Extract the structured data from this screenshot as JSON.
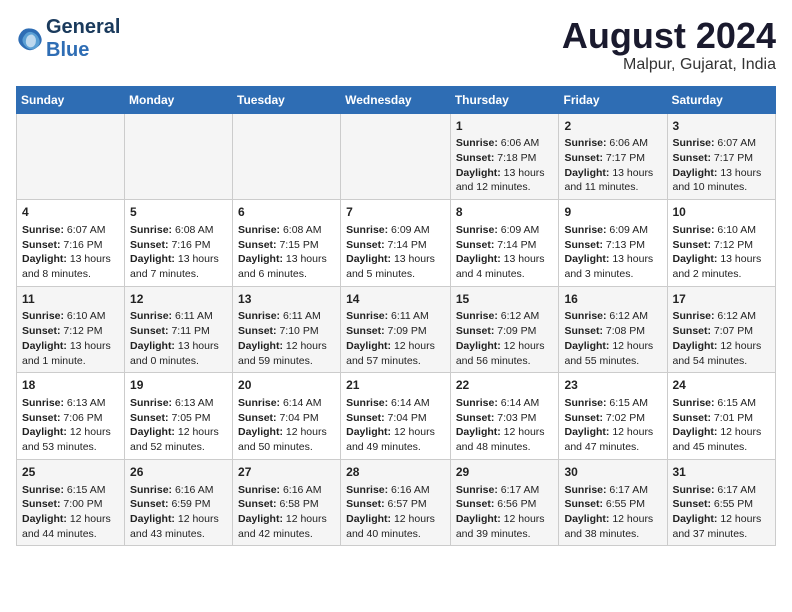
{
  "header": {
    "logo_line1": "General",
    "logo_line2": "Blue",
    "month_title": "August 2024",
    "location": "Malpur, Gujarat, India"
  },
  "weekdays": [
    "Sunday",
    "Monday",
    "Tuesday",
    "Wednesday",
    "Thursday",
    "Friday",
    "Saturday"
  ],
  "weeks": [
    [
      {
        "day": "",
        "info": ""
      },
      {
        "day": "",
        "info": ""
      },
      {
        "day": "",
        "info": ""
      },
      {
        "day": "",
        "info": ""
      },
      {
        "day": "1",
        "info": "Sunrise: 6:06 AM\nSunset: 7:18 PM\nDaylight: 13 hours and 12 minutes."
      },
      {
        "day": "2",
        "info": "Sunrise: 6:06 AM\nSunset: 7:17 PM\nDaylight: 13 hours and 11 minutes."
      },
      {
        "day": "3",
        "info": "Sunrise: 6:07 AM\nSunset: 7:17 PM\nDaylight: 13 hours and 10 minutes."
      }
    ],
    [
      {
        "day": "4",
        "info": "Sunrise: 6:07 AM\nSunset: 7:16 PM\nDaylight: 13 hours and 8 minutes."
      },
      {
        "day": "5",
        "info": "Sunrise: 6:08 AM\nSunset: 7:16 PM\nDaylight: 13 hours and 7 minutes."
      },
      {
        "day": "6",
        "info": "Sunrise: 6:08 AM\nSunset: 7:15 PM\nDaylight: 13 hours and 6 minutes."
      },
      {
        "day": "7",
        "info": "Sunrise: 6:09 AM\nSunset: 7:14 PM\nDaylight: 13 hours and 5 minutes."
      },
      {
        "day": "8",
        "info": "Sunrise: 6:09 AM\nSunset: 7:14 PM\nDaylight: 13 hours and 4 minutes."
      },
      {
        "day": "9",
        "info": "Sunrise: 6:09 AM\nSunset: 7:13 PM\nDaylight: 13 hours and 3 minutes."
      },
      {
        "day": "10",
        "info": "Sunrise: 6:10 AM\nSunset: 7:12 PM\nDaylight: 13 hours and 2 minutes."
      }
    ],
    [
      {
        "day": "11",
        "info": "Sunrise: 6:10 AM\nSunset: 7:12 PM\nDaylight: 13 hours and 1 minute."
      },
      {
        "day": "12",
        "info": "Sunrise: 6:11 AM\nSunset: 7:11 PM\nDaylight: 13 hours and 0 minutes."
      },
      {
        "day": "13",
        "info": "Sunrise: 6:11 AM\nSunset: 7:10 PM\nDaylight: 12 hours and 59 minutes."
      },
      {
        "day": "14",
        "info": "Sunrise: 6:11 AM\nSunset: 7:09 PM\nDaylight: 12 hours and 57 minutes."
      },
      {
        "day": "15",
        "info": "Sunrise: 6:12 AM\nSunset: 7:09 PM\nDaylight: 12 hours and 56 minutes."
      },
      {
        "day": "16",
        "info": "Sunrise: 6:12 AM\nSunset: 7:08 PM\nDaylight: 12 hours and 55 minutes."
      },
      {
        "day": "17",
        "info": "Sunrise: 6:12 AM\nSunset: 7:07 PM\nDaylight: 12 hours and 54 minutes."
      }
    ],
    [
      {
        "day": "18",
        "info": "Sunrise: 6:13 AM\nSunset: 7:06 PM\nDaylight: 12 hours and 53 minutes."
      },
      {
        "day": "19",
        "info": "Sunrise: 6:13 AM\nSunset: 7:05 PM\nDaylight: 12 hours and 52 minutes."
      },
      {
        "day": "20",
        "info": "Sunrise: 6:14 AM\nSunset: 7:04 PM\nDaylight: 12 hours and 50 minutes."
      },
      {
        "day": "21",
        "info": "Sunrise: 6:14 AM\nSunset: 7:04 PM\nDaylight: 12 hours and 49 minutes."
      },
      {
        "day": "22",
        "info": "Sunrise: 6:14 AM\nSunset: 7:03 PM\nDaylight: 12 hours and 48 minutes."
      },
      {
        "day": "23",
        "info": "Sunrise: 6:15 AM\nSunset: 7:02 PM\nDaylight: 12 hours and 47 minutes."
      },
      {
        "day": "24",
        "info": "Sunrise: 6:15 AM\nSunset: 7:01 PM\nDaylight: 12 hours and 45 minutes."
      }
    ],
    [
      {
        "day": "25",
        "info": "Sunrise: 6:15 AM\nSunset: 7:00 PM\nDaylight: 12 hours and 44 minutes."
      },
      {
        "day": "26",
        "info": "Sunrise: 6:16 AM\nSunset: 6:59 PM\nDaylight: 12 hours and 43 minutes."
      },
      {
        "day": "27",
        "info": "Sunrise: 6:16 AM\nSunset: 6:58 PM\nDaylight: 12 hours and 42 minutes."
      },
      {
        "day": "28",
        "info": "Sunrise: 6:16 AM\nSunset: 6:57 PM\nDaylight: 12 hours and 40 minutes."
      },
      {
        "day": "29",
        "info": "Sunrise: 6:17 AM\nSunset: 6:56 PM\nDaylight: 12 hours and 39 minutes."
      },
      {
        "day": "30",
        "info": "Sunrise: 6:17 AM\nSunset: 6:55 PM\nDaylight: 12 hours and 38 minutes."
      },
      {
        "day": "31",
        "info": "Sunrise: 6:17 AM\nSunset: 6:55 PM\nDaylight: 12 hours and 37 minutes."
      }
    ]
  ]
}
